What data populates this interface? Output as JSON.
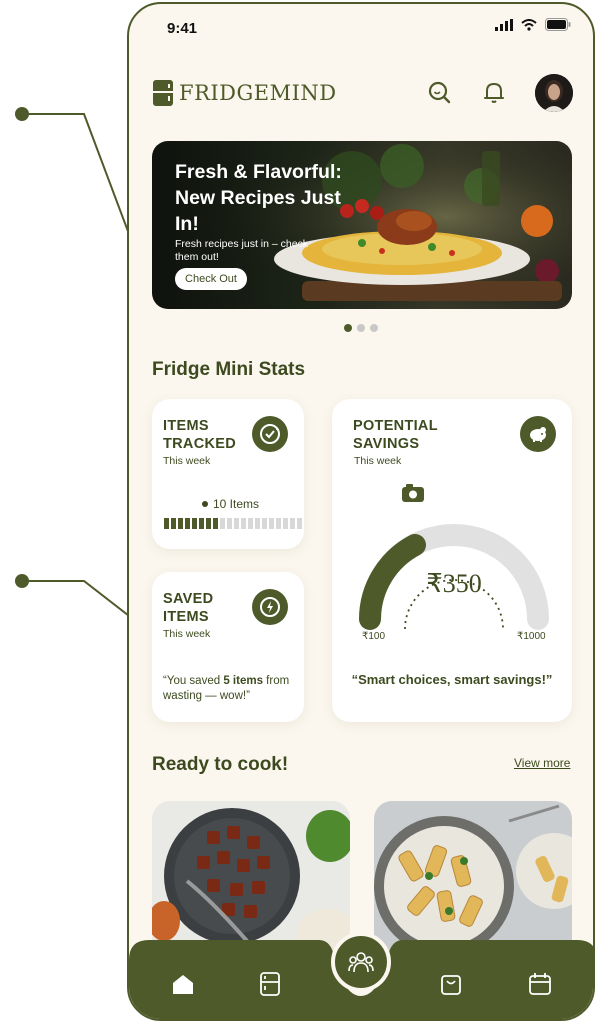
{
  "status": {
    "time": "9:41"
  },
  "app": {
    "name": "FRIDGEMIND"
  },
  "banner": {
    "title": "Fresh & Flavorful: New Recipes Just In!",
    "subtitle": "Fresh recipes just in – check them out!",
    "button": "Check Out",
    "slides": 3,
    "active_slide": 1
  },
  "stats": {
    "section_title": "Fridge Mini Stats",
    "items_tracked": {
      "title_line1": "ITEMS",
      "title_line2": "TRACKED",
      "period": "This week",
      "count_label": "10 Items",
      "segments_total": 20,
      "segments_filled": 8
    },
    "saved_items": {
      "title_line1": "SAVED",
      "title_line2": "ITEMS",
      "period": "This week",
      "quote_prefix": "“You saved ",
      "quote_bold": "5 items",
      "quote_suffix": " from wasting — wow!”"
    },
    "potential_savings": {
      "title_line1": "POTENTIAL",
      "title_line2": "SAVINGS",
      "period": "This week",
      "value": "₹350",
      "min": "₹100",
      "max": "₹1000",
      "quote": "“Smart choices, smart savings!”"
    }
  },
  "cook": {
    "section_title": "Ready to cook!",
    "view_more": "View more"
  },
  "colors": {
    "primary": "#4e5a2a",
    "background": "#fbf7ee",
    "card": "#ffffff"
  }
}
